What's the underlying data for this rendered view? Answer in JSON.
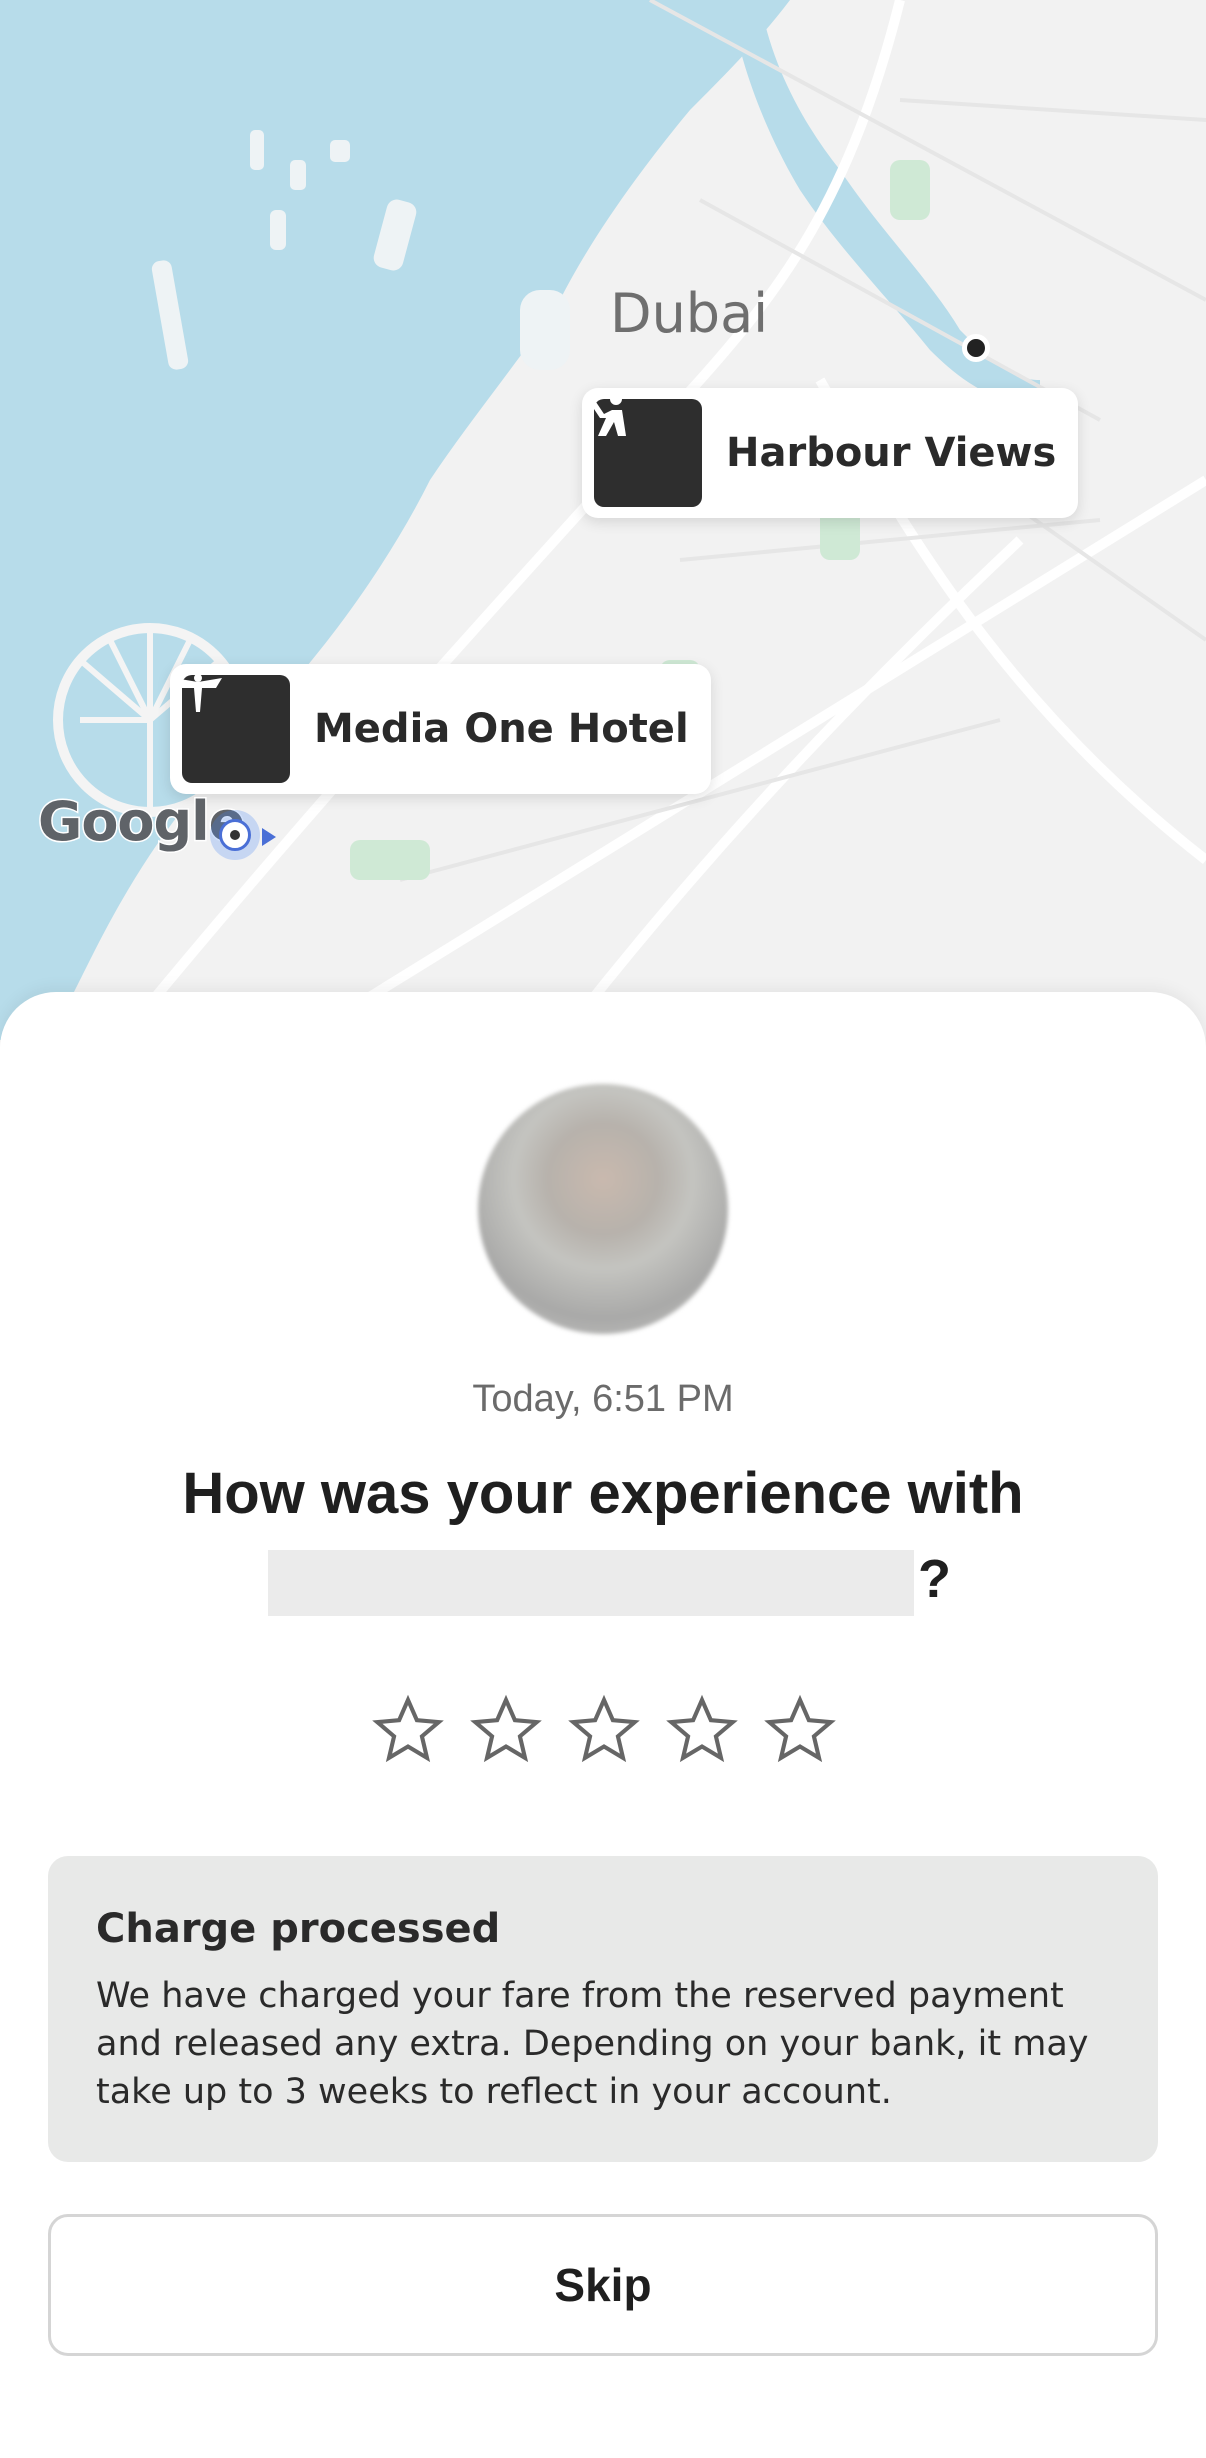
{
  "map": {
    "city_label": "Dubai",
    "markers": [
      {
        "label": "Harbour Views",
        "icon": "person-waving-icon"
      },
      {
        "label": "Media One Hotel",
        "icon": "bird-statue-icon"
      }
    ],
    "attribution": "Google",
    "colors": {
      "water": "#b7dcea",
      "land": "#f2f2f2",
      "road": "#ffffff",
      "park": "#cfe9d5"
    }
  },
  "sheet": {
    "timestamp": "Today, 6:51 PM",
    "question": "How was your experience with",
    "question_suffix": "?",
    "rating": {
      "max": 5,
      "selected": 0,
      "star_icon": "star-outline-icon"
    },
    "notice": {
      "title": "Charge processed",
      "body": "We have charged your fare from the reserved payment and released any extra. Depending on your bank, it may take up to 3 weeks to reflect in your account."
    },
    "skip_label": "Skip"
  }
}
